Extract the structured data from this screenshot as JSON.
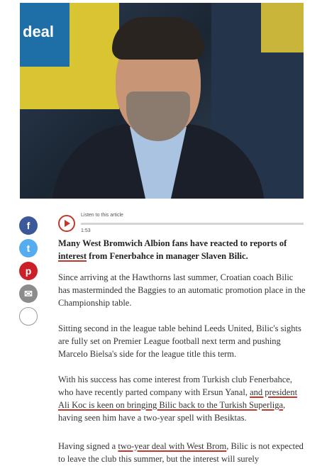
{
  "hero": {
    "photo_text": "deal"
  },
  "social": {
    "facebook": "f",
    "twitter": "t",
    "pinterest": "p",
    "email": "✉",
    "comment": "…"
  },
  "audio": {
    "label": "Listen to this article",
    "time": "1:53"
  },
  "article": {
    "lead_1": "Many West Bromwich Albion fans have reacted to reports of ",
    "lead_2": "interest",
    "lead_3": " from Fenerbahce in manager Slaven Bilic.",
    "p1": "Since arriving at the Hawthorns last summer, Croatian coach Bilic has masterminded the Baggies to an automatic promotion place in the Championship table.",
    "p2": "Sitting second in the league table behind Leeds United, Bilic's sights are fully set on Premier League football next term and pushing Marcelo Bielsa's side for the league title this term.",
    "p3_a": "With his success has come interest from Turkish club Fenerbahce, who have recently parted company with Ersun Yanal, ",
    "p3_b": "and president Ali Koc is keen on bringing Bilic back to the Turkish Superliga",
    "p3_c": ", having seen him have a two-year spell with Besiktas.",
    "p4_a": "Having signed a ",
    "p4_b": "two-year deal with West Brom",
    "p4_c": ", Bilic is not expected to leave the club this summer, but the interest will surely"
  }
}
